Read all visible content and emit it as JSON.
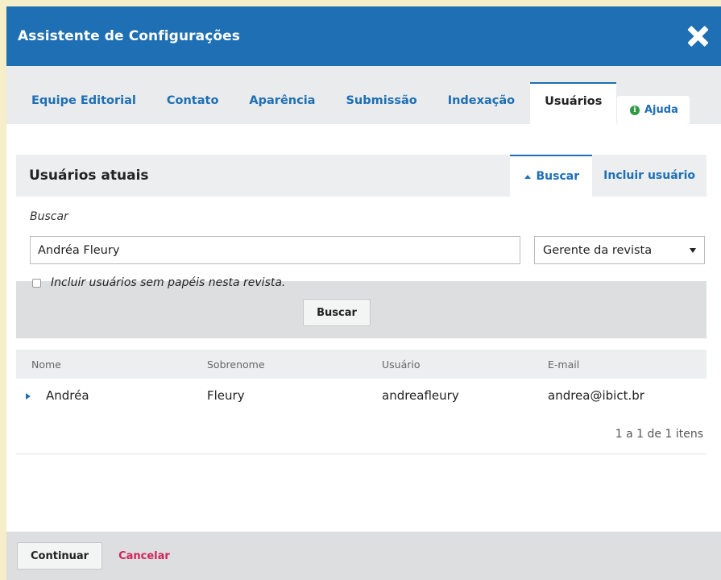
{
  "modal": {
    "title": "Assistente de Configurações"
  },
  "tabs": [
    {
      "label": "Equipe Editorial"
    },
    {
      "label": "Contato"
    },
    {
      "label": "Aparência"
    },
    {
      "label": "Submissão"
    },
    {
      "label": "Indexação"
    },
    {
      "label": "Usuários",
      "active": true
    }
  ],
  "help": {
    "label": "Ajuda",
    "icon": "info-icon"
  },
  "panel": {
    "heading": "Usuários atuais",
    "search_action": "Buscar",
    "add_user_action": "Incluir usuário"
  },
  "search": {
    "label": "Buscar",
    "value": "Andréa Fleury",
    "role_selected": "Gerente da revista",
    "checkbox_label": "Incluir usuários sem papéis nesta revista.",
    "checkbox_checked": false,
    "button_label": "Buscar"
  },
  "table": {
    "columns": [
      "Nome",
      "Sobrenome",
      "Usuário",
      "E-mail"
    ],
    "rows": [
      {
        "first_name": "Andréa",
        "last_name": "Fleury",
        "username": "andreafleury",
        "email": "andrea@ibict.br"
      }
    ],
    "pagination": "1 a 1 de 1 itens"
  },
  "footer": {
    "continue_label": "Continuar",
    "cancel_label": "Cancelar"
  },
  "colors": {
    "accent": "#1e6fb4",
    "cancel": "#d0245b",
    "background": "#f6edc9",
    "help_icon": "#2e9a44"
  }
}
